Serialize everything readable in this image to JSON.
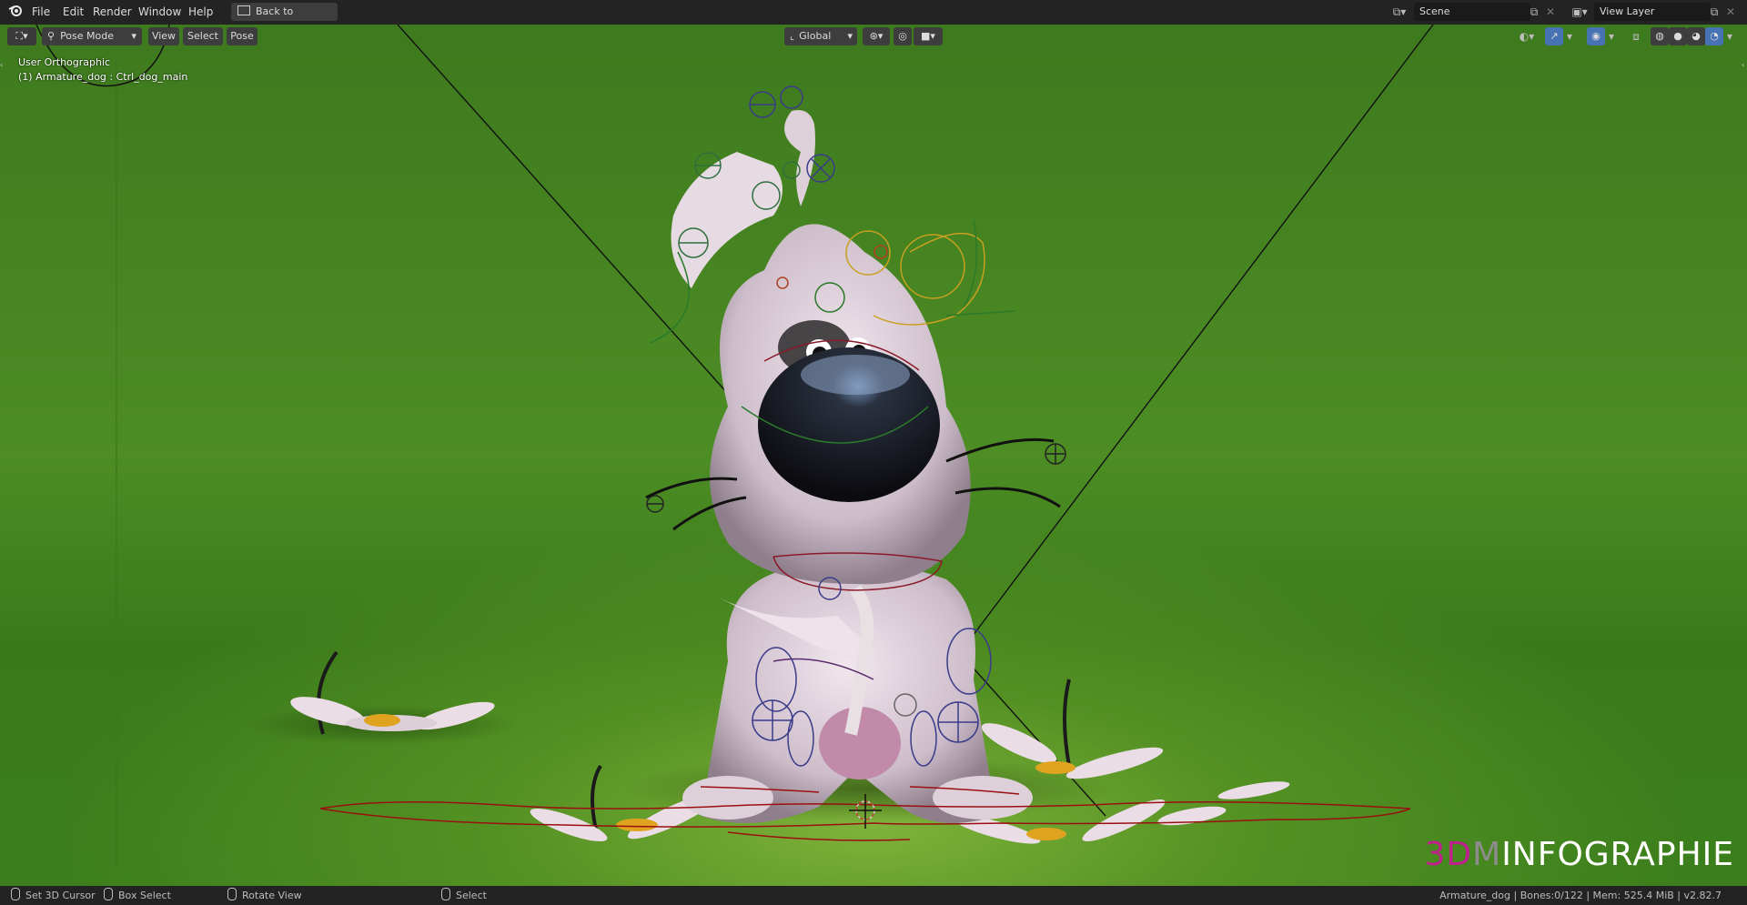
{
  "topbar": {
    "menus": [
      "File",
      "Edit",
      "Render",
      "Window",
      "Help"
    ],
    "back_button": "Back to Previous",
    "scene": "Scene",
    "view_layer": "View Layer"
  },
  "viewport_header": {
    "mode": "Pose Mode",
    "menus": [
      "View",
      "Select",
      "Pose"
    ],
    "orientation": "Global"
  },
  "viewport": {
    "view_name": "User Orthographic",
    "object_info": "(1) Armature_dog : Ctrl_dog_main"
  },
  "statusbar": {
    "left_items": [
      "Set 3D Cursor",
      "Box Select",
      "Rotate View",
      "Select"
    ],
    "stats": "Armature_dog | Bones:0/122 | Mem: 525.4 MiB | v2.82.7"
  },
  "watermark": {
    "part1": "3D",
    "part2": "M",
    "part3": "INFOGRAPHIE",
    "color1": "#c0208e",
    "color2": "#8c8c8c",
    "color3": "#ffffff"
  },
  "colors": {
    "green_bg": "#4d8d24",
    "accent_blue": "#4772b3"
  }
}
